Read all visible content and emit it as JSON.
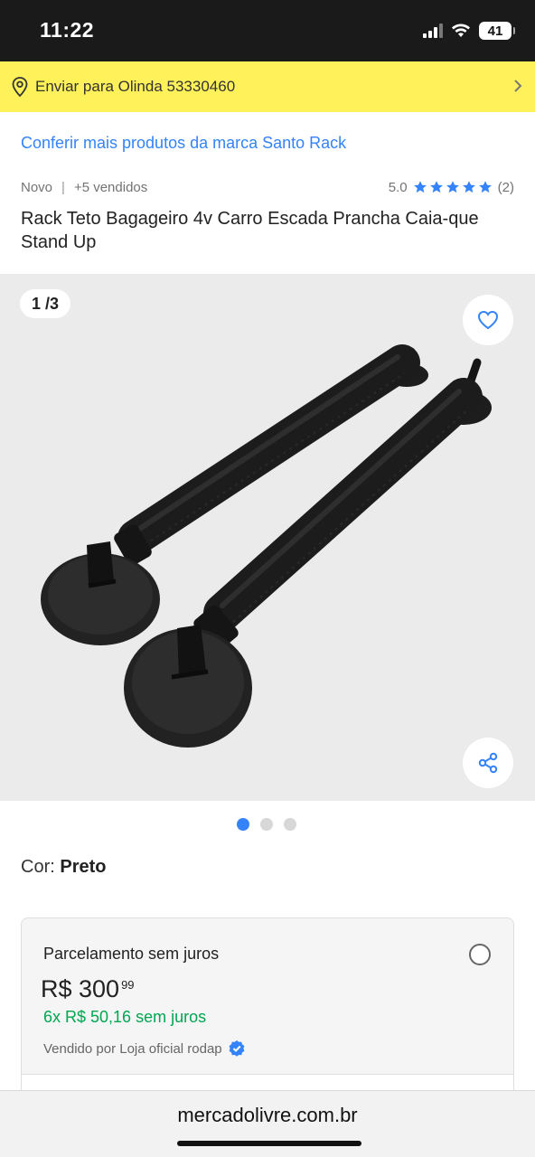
{
  "status_bar": {
    "time": "11:22",
    "battery": "41"
  },
  "shipping": {
    "text": "Enviar para Olinda 53330460"
  },
  "brand_link": "Conferir mais produtos da marca Santo Rack",
  "meta": {
    "condition": "Novo",
    "sold": "+5 vendidos",
    "rating": "5.0",
    "stars": 5,
    "reviews": "(2)"
  },
  "title": "Rack Teto Bagageiro 4v Carro Escada Prancha Caia-que Stand Up",
  "gallery": {
    "counter": "1 /3",
    "image_icon": "roof-rack-bars-image",
    "dots": 3,
    "active_dot": 0
  },
  "color": {
    "label": "Cor:",
    "value": "Preto"
  },
  "purchase": {
    "title": "Parcelamento sem juros",
    "price": "R$ 300",
    "cents": "99",
    "installments": "6x R$ 50,16 sem juros",
    "seller": "Vendido por Loja oficial rodap"
  },
  "browser": {
    "url": "mercadolivre.com.br"
  },
  "colors": {
    "accent": "#3483fa",
    "yellow": "#fff159",
    "green": "#00a650"
  }
}
